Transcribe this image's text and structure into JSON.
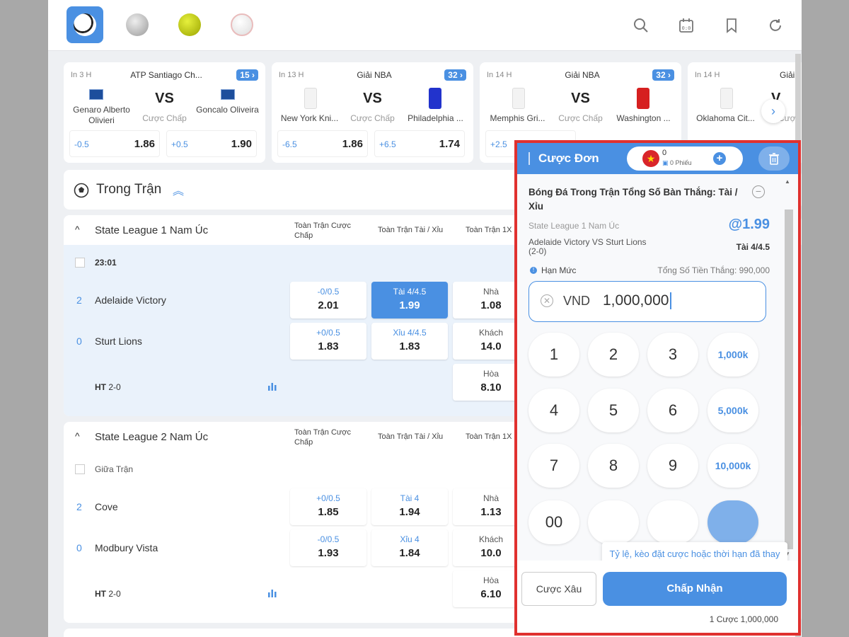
{
  "sports": [
    "soccer-ball",
    "basketball",
    "tennis-ball",
    "baseball"
  ],
  "cards": [
    {
      "in": "In 3 H",
      "league": "ATP Santiago Ch...",
      "count": "15",
      "home": "Genaro Alberto Olivieri",
      "away": "Goncalo Oliveira",
      "vs": "VS",
      "handicap_label": "Cược Chấp",
      "home_line": "-0.5",
      "home_odd": "1.86",
      "away_line": "+0.5",
      "away_odd": "1.90"
    },
    {
      "in": "In 13 H",
      "league": "Giải NBA",
      "count": "32",
      "home": "New York Kni...",
      "away": "Philadelphia ...",
      "vs": "VS",
      "handicap_label": "Cược Chấp",
      "home_line": "-6.5",
      "home_odd": "1.86",
      "away_line": "+6.5",
      "away_odd": "1.74"
    },
    {
      "in": "In 14 H",
      "league": "Giải NBA",
      "count": "32",
      "home": "Memphis Gri...",
      "away": "Washington ...",
      "vs": "VS",
      "handicap_label": "Cược Chấp",
      "home_line": "+2.5",
      "home_odd": "",
      "away_line": "",
      "away_odd": ""
    },
    {
      "in": "In 14 H",
      "league": "Giải",
      "count": "",
      "home": "Oklahoma Cit...",
      "away": "",
      "vs": "V",
      "handicap_label": "Cược",
      "home_line": "",
      "home_odd": "",
      "away_line": "",
      "away_odd": ""
    }
  ],
  "section": {
    "title": "Trong Trận"
  },
  "columns": {
    "handicap": "Toàn Trận Cược Chấp",
    "ou": "Toàn Trận Tài / Xỉu",
    "x12": "Toàn Trận 1X"
  },
  "leagues": [
    {
      "name": "State League 1 Nam Úc",
      "time": "23:01",
      "home_score": "2",
      "home": "Adelaide Victory",
      "away_score": "0",
      "away": "Sturt Lions",
      "ht_label": "HT",
      "ht": "2-0",
      "hcp": [
        {
          "h": "-0/0.5",
          "v": "2.01"
        },
        {
          "h": "+0/0.5",
          "v": "1.83"
        }
      ],
      "ou": [
        {
          "h": "Tài 4/4.5",
          "v": "1.99"
        },
        {
          "h": "Xỉu 4/4.5",
          "v": "1.83"
        }
      ],
      "x12": [
        {
          "h": "Nhà",
          "v": "1.08"
        },
        {
          "h": "Khách",
          "v": "14.0"
        },
        {
          "h": "Hòa",
          "v": "8.10"
        }
      ]
    },
    {
      "name": "State League 2 Nam Úc",
      "time": "Giữa Trận",
      "home_score": "2",
      "home": "Cove",
      "away_score": "0",
      "away": "Modbury Vista",
      "ht_label": "HT",
      "ht": "2-0",
      "hcp": [
        {
          "h": "+0/0.5",
          "v": "1.85"
        },
        {
          "h": "-0/0.5",
          "v": "1.93"
        }
      ],
      "ou": [
        {
          "h": "Tài 4",
          "v": "1.94"
        },
        {
          "h": "Xỉu 4",
          "v": "1.84"
        }
      ],
      "x12": [
        {
          "h": "Nhà",
          "v": "1.13"
        },
        {
          "h": "Khách",
          "v": "10.0"
        },
        {
          "h": "Hòa",
          "v": "6.10"
        }
      ]
    }
  ],
  "slip": {
    "title": "Cược Đơn",
    "count": "0",
    "tickets": "0 Phiếu",
    "market": "Bóng Đá Trong Trận Tổng Số Bàn Thắng: Tài / Xỉu",
    "league": "State League 1 Nam Úc",
    "odds": "@1.99",
    "match": "Adelaide Victory  VS  Sturt Lions  (2-0)",
    "selection": "Tài 4/4.5",
    "limit_label": "Hạn Mức",
    "payout": "Tổng Số Tiền Thắng: 990,000",
    "currency": "VND",
    "stake": "1,000,000",
    "keys": [
      "1",
      "2",
      "3",
      "1,000k",
      "4",
      "5",
      "6",
      "5,000k",
      "7",
      "8",
      "9",
      "10,000k",
      "00"
    ],
    "tooltip": "Tỷ lệ, kèo đặt cược hoặc thời hạn đã thay đổi",
    "parlay_button": "Cược Xâu",
    "accept_button": "Chấp Nhận",
    "summary": "1 Cược 1,000,000"
  },
  "colors": {
    "accent": "#4a90e2",
    "highlight": "#e0312f"
  }
}
